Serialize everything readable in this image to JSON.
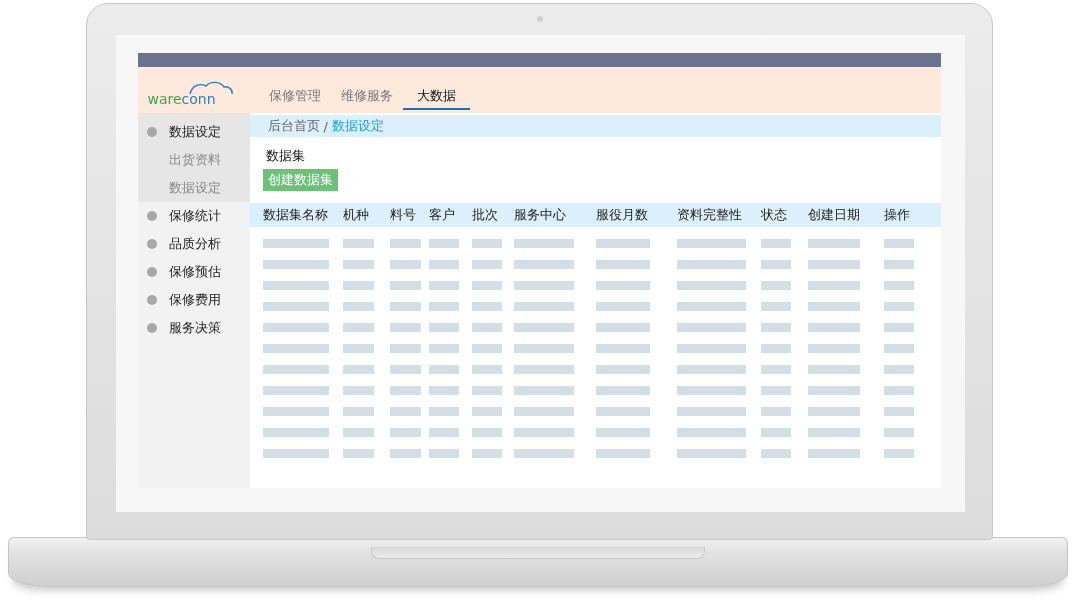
{
  "logo": {
    "part_1": "ware",
    "part_2": "conn"
  },
  "tabs": [
    {
      "label": "保修管理",
      "selected": false
    },
    {
      "label": "维修服务",
      "selected": false
    },
    {
      "label": "大数据",
      "selected": true
    }
  ],
  "sidebar": {
    "items": [
      {
        "label": "数据设定",
        "expanded": true,
        "children": [
          {
            "label": "出货资料"
          },
          {
            "label": "数据设定"
          }
        ]
      },
      {
        "label": "保修统计",
        "expanded": false
      },
      {
        "label": "品质分析",
        "expanded": false
      },
      {
        "label": "保修预估",
        "expanded": false
      },
      {
        "label": "保修费用",
        "expanded": false
      },
      {
        "label": "服务决策",
        "expanded": false
      }
    ]
  },
  "breadcrumb": {
    "home": "后台首页",
    "separator": "/",
    "current": "数据设定"
  },
  "section_title": "数据集",
  "create_button": "创建数据集",
  "table": {
    "columns": [
      "数据集名称",
      "机种",
      "料号",
      "客户",
      "批次",
      "服务中心",
      "服役月数",
      "资料完整性",
      "状态",
      "创建日期",
      "操作"
    ]
  }
}
